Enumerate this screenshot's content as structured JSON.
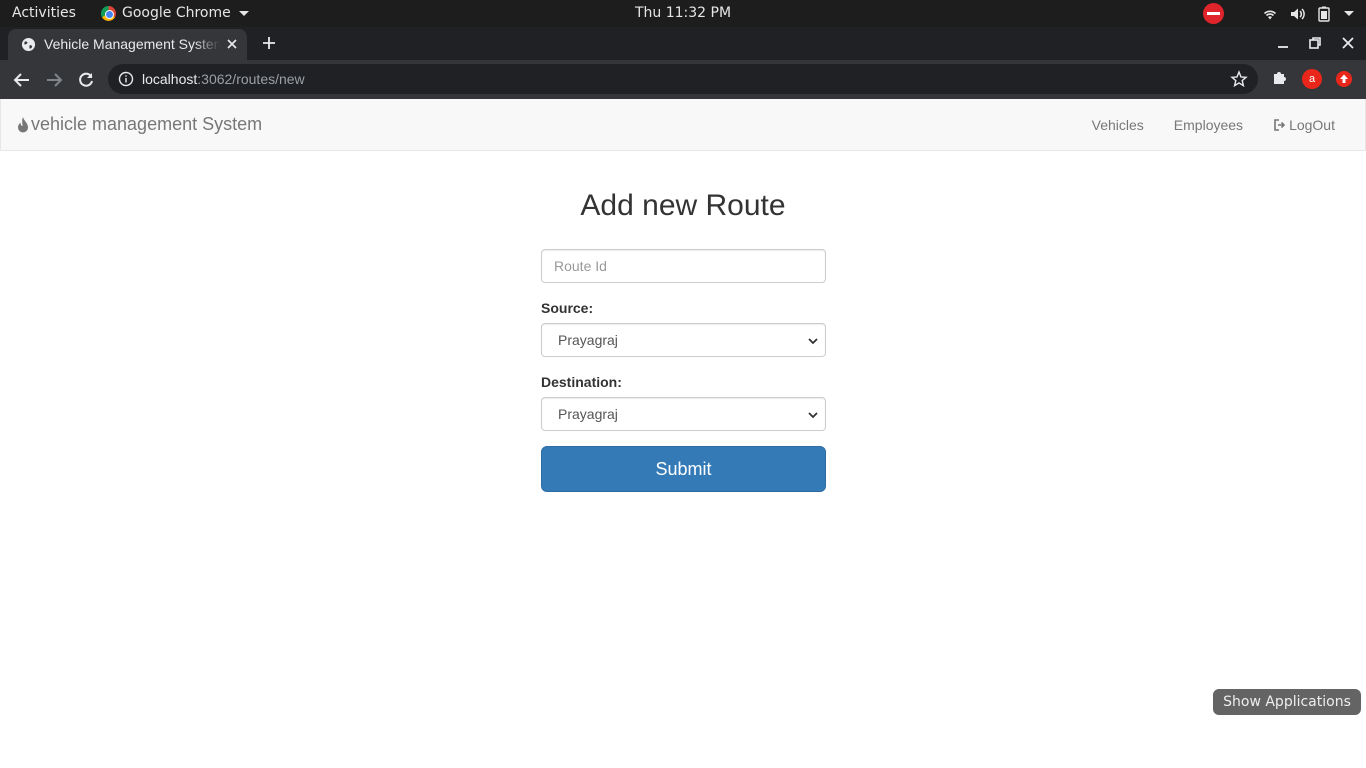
{
  "os": {
    "activities": "Activities",
    "app_name": "Google Chrome",
    "clock": "Thu 11:32 PM"
  },
  "browser": {
    "tab_title": "Vehicle Management System",
    "url_host": "localhost",
    "url_path": ":3062/routes/new",
    "profile_initial": "a"
  },
  "navbar": {
    "brand": "vehicle management System",
    "links": [
      {
        "label": "Vehicles"
      },
      {
        "label": "Employees"
      },
      {
        "label": "LogOut"
      }
    ]
  },
  "form": {
    "heading": "Add new Route",
    "route_id_placeholder": "Route Id",
    "route_id_value": "",
    "source_label": "Source:",
    "source_selected": "Prayagraj",
    "destination_label": "Destination:",
    "destination_selected": "Prayagraj",
    "submit_label": "Submit"
  },
  "overlay": {
    "show_applications": "Show Applications"
  },
  "colors": {
    "primary_button": "#337ab7",
    "navbar_bg": "#f8f8f8",
    "browser_frame": "#202124",
    "profile_badge": "#e8261a"
  }
}
